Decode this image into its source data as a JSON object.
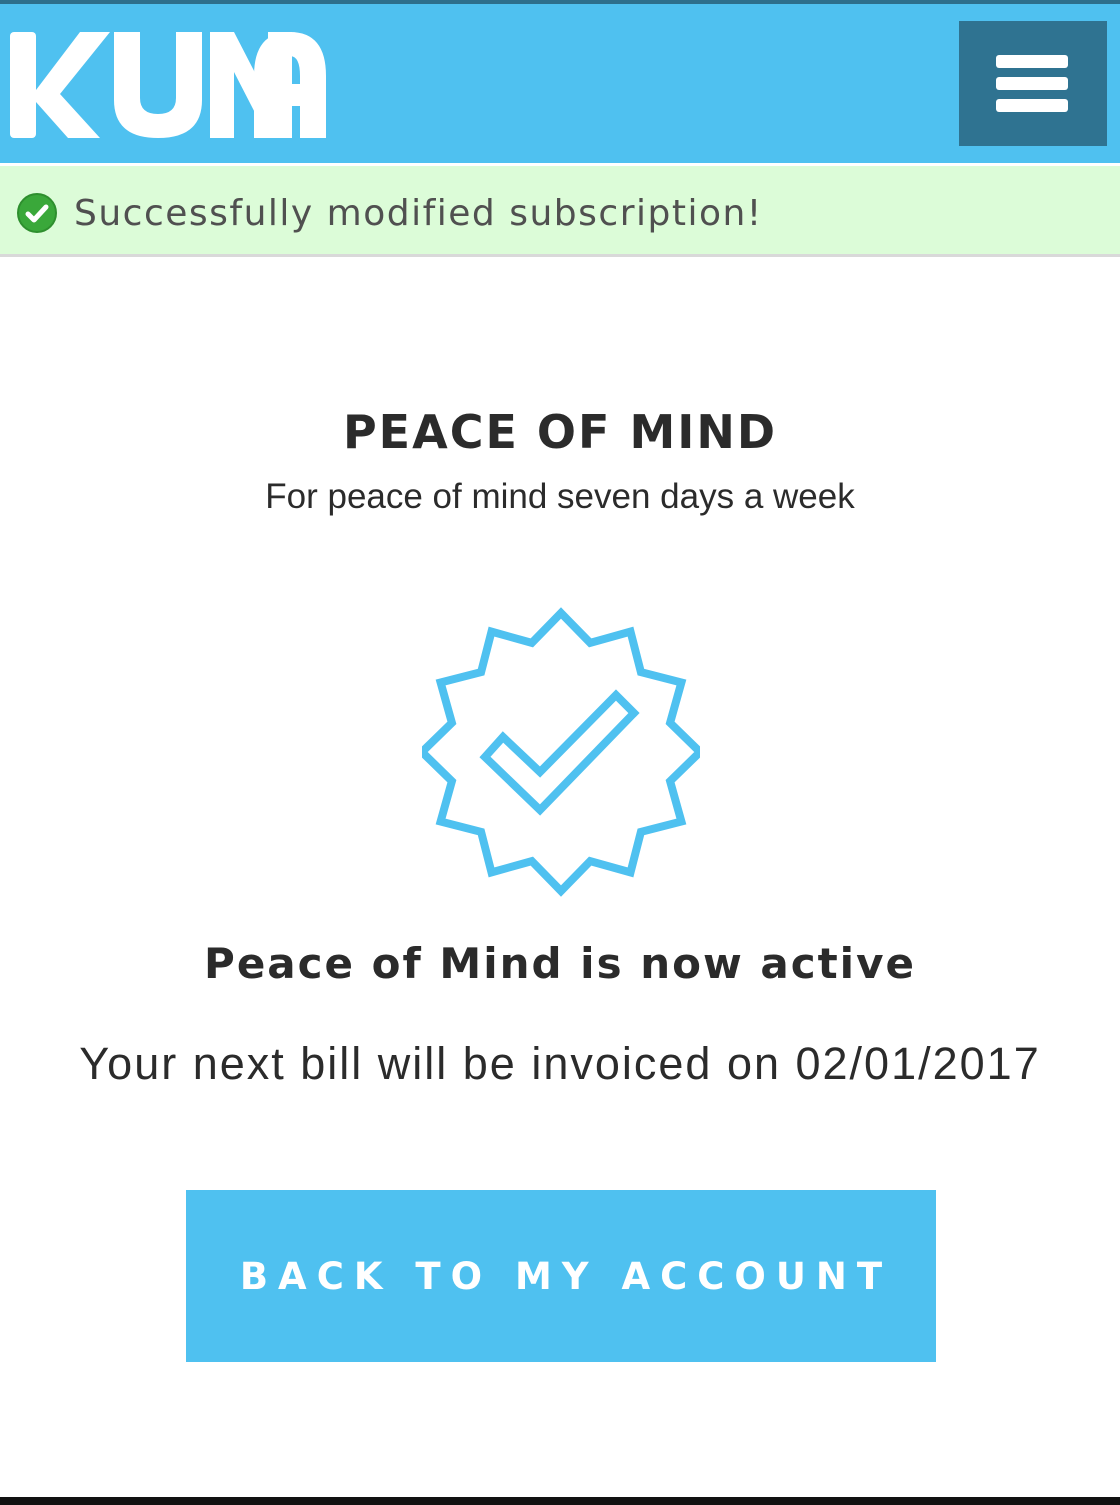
{
  "header": {
    "logo_text": "KUNA",
    "brand_color": "#4fc1f0",
    "menu_icon": "hamburger-menu-icon"
  },
  "alert": {
    "icon": "check-circle-icon",
    "message": "Successfully modified subscription!",
    "background_color": "#dcfcd8",
    "icon_color": "#3aa83a"
  },
  "plan": {
    "name": "PEACE OF MIND",
    "description": "For peace of mind seven days a week",
    "badge_icon": "verified-badge-check-icon"
  },
  "status": {
    "title": "Peace of Mind is now active",
    "next_bill": "Your next bill will be invoiced on 02/01/2017"
  },
  "actions": {
    "back_label": "BACK TO MY ACCOUNT"
  }
}
